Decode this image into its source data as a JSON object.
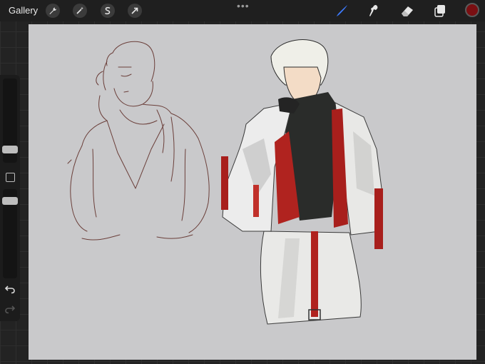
{
  "topbar": {
    "gallery_label": "Gallery",
    "left_tools": [
      {
        "icon": "wrench-icon",
        "name": "actions"
      },
      {
        "icon": "magic-wand-icon",
        "name": "adjustments"
      },
      {
        "icon": "selection-s-icon",
        "name": "selection"
      },
      {
        "icon": "transform-arrow-icon",
        "name": "transform"
      }
    ],
    "more_label": "•••",
    "right_tools": [
      {
        "icon": "brush-icon",
        "active": true
      },
      {
        "icon": "smudge-icon",
        "active": false
      },
      {
        "icon": "eraser-icon",
        "active": false
      },
      {
        "icon": "layers-icon",
        "active": false
      }
    ],
    "current_color": "#7a0f12",
    "active_tool_color": "#3d7bff"
  },
  "sidebar": {
    "icons": [
      "undo-icon",
      "redo-icon",
      "modify-square-icon"
    ]
  },
  "canvas": {
    "background": "#c9c9cb"
  }
}
